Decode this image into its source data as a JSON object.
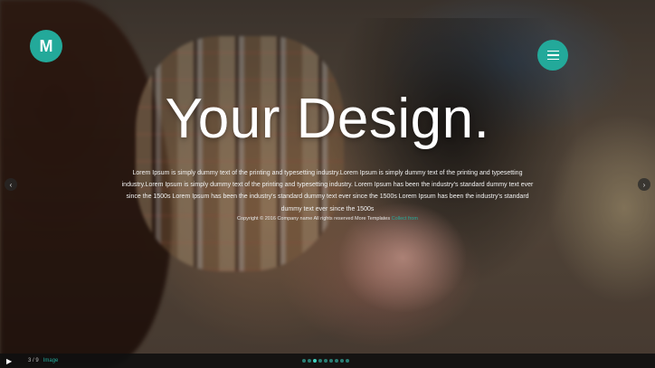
{
  "brand": {
    "logo_letter": "M",
    "accent": "#23a99a"
  },
  "hero": {
    "headline": "Your Design.",
    "description": "Lorem Ipsum is simply dummy text of the printing and typesetting industry.Lorem Ipsum is simply dummy text of the printing and typesetting industry.Lorem Ipsum is simply dummy text of the printing and typesetting industry. Lorem Ipsum has been the industry's standard dummy text ever since the 1500s Lorem Ipsum has been the industry's standard dummy text ever since the 1500s Lorem Ipsum has been the industry's standard dummy text ever since the 1500s",
    "copyright": "Copyright © 2016 Company name All rights reserved More Templates",
    "copyright_link": "Collect from"
  },
  "nav": {
    "menu_icon": "hamburger-icon",
    "prev_icon": "chevron-left-icon",
    "next_icon": "chevron-right-icon"
  },
  "slider_bar": {
    "play_icon": "play-icon",
    "play_glyph": "▶",
    "counter": "3 / 9",
    "label": "Image",
    "dots_total": 9,
    "dots_active": 3
  }
}
